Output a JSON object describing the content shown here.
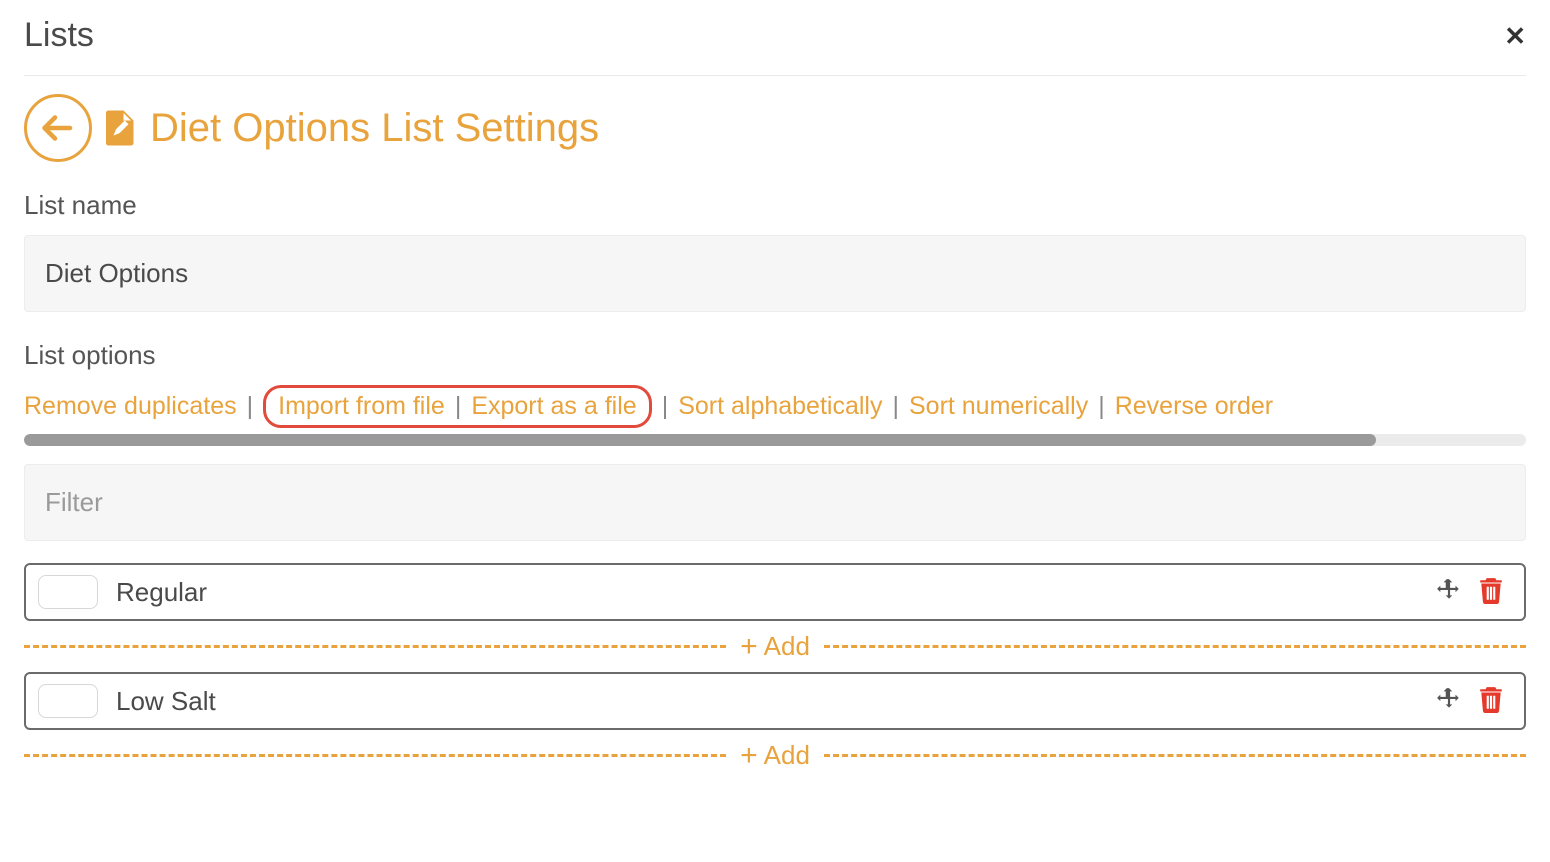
{
  "header": {
    "title": "Lists"
  },
  "page": {
    "heading": "Diet Options List Settings"
  },
  "form": {
    "list_name_label": "List name",
    "list_name_value": "Diet Options",
    "list_options_label": "List options",
    "filter_placeholder": "Filter"
  },
  "actions": {
    "remove_duplicates": "Remove duplicates",
    "import_from_file": "Import from file",
    "export_as_file": "Export as a file",
    "sort_alpha": "Sort alphabetically",
    "sort_numeric": "Sort numerically",
    "reverse_order": "Reverse order"
  },
  "separator": "|",
  "progress_percent": 90,
  "add_label": "Add",
  "items": [
    {
      "label": "Regular"
    },
    {
      "label": "Low Salt"
    }
  ],
  "colors": {
    "accent": "#e8a33d",
    "danger": "#e53a2b",
    "highlight_border": "#e24a3b"
  }
}
